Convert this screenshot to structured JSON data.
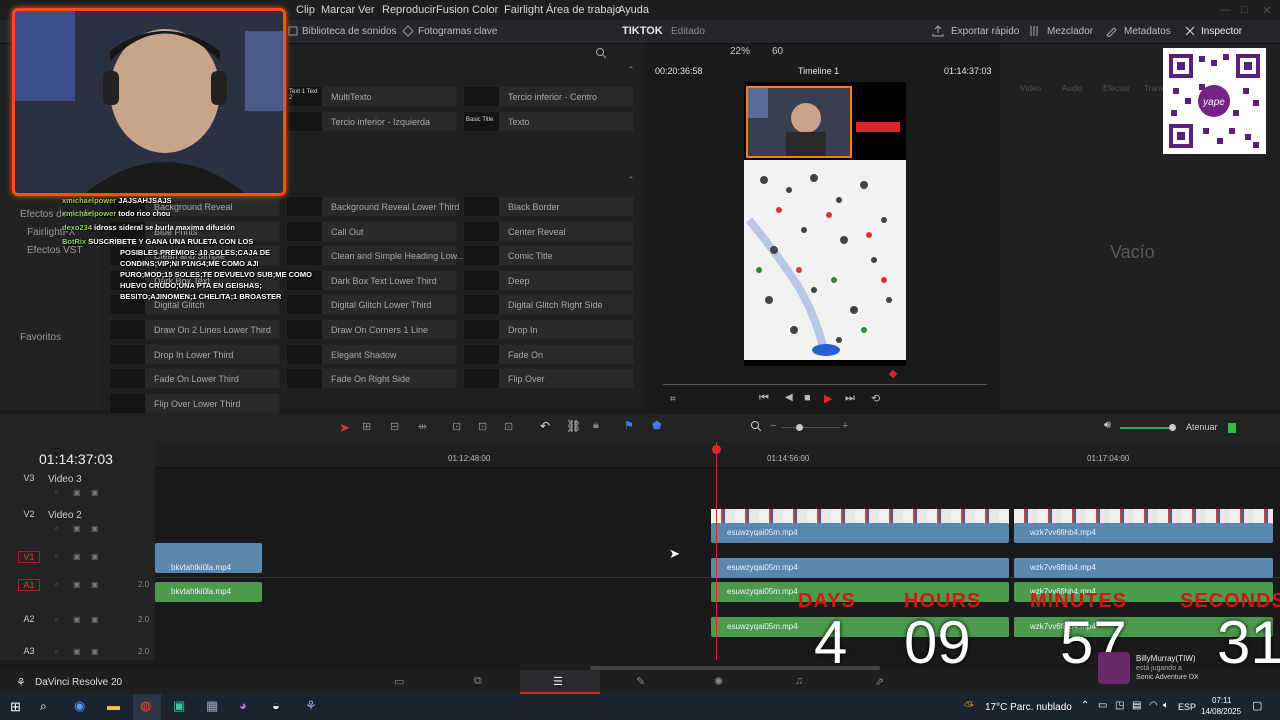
{
  "menu": {
    "items": [
      "Clip",
      "Marcar",
      "Ver",
      "Reproducir",
      "Fusion",
      "Color",
      "Fairlight",
      "Área de trabajo",
      "Ayuda"
    ]
  },
  "toolbar": {
    "sound_library": "Biblioteca de sonidos",
    "keyframes": "Fotogramas clave",
    "project_name": "TIKTOK",
    "project_status": "Editado",
    "zoom": "22%",
    "fps": "60",
    "quick_export": "Exportar rápido",
    "mixer": "Mezclador",
    "metadata": "Metadatos",
    "inspector": "Inspector"
  },
  "left_panel": {
    "items": [
      "Efectos de audio",
      "FairlightFX",
      "Efectos VST",
      "Favoritos"
    ]
  },
  "effects": {
    "top_tiles": [
      {
        "thumb": "Text 1 Text 2",
        "label": "MultiTexto"
      },
      {
        "thumb": "",
        "label": "Tercio inferior - Centro"
      },
      {
        "thumb": "",
        "label": "Tercio inferior - Izquierda"
      },
      {
        "thumb": "Basic Title",
        "label": "Texto"
      }
    ],
    "tiles": [
      {
        "label": "Background Reveal"
      },
      {
        "label": "Background Reveal Lower Third"
      },
      {
        "label": "Black Border"
      },
      {
        "label": "Blue Prints"
      },
      {
        "label": "Call Out"
      },
      {
        "label": "Center Reveal"
      },
      {
        "label": "Clean and Simple"
      },
      {
        "label": "Clean and Simple Heading Low..."
      },
      {
        "label": "Comic Title"
      },
      {
        "label": "Dark Box Text"
      },
      {
        "label": "Dark Box Text Lower Third"
      },
      {
        "label": "Deep"
      },
      {
        "label": "Digital Glitch"
      },
      {
        "label": "Digital Glitch Lower Third"
      },
      {
        "label": "Digital Glitch Right Side"
      },
      {
        "label": "Draw On 2 Lines Lower Third"
      },
      {
        "label": "Draw On Corners 1 Line"
      },
      {
        "label": "Drop In"
      },
      {
        "label": "Drop In Lower Third"
      },
      {
        "label": "Elegant Shadow"
      },
      {
        "label": "Fade On"
      },
      {
        "label": "Fade On Lower Third"
      },
      {
        "label": "Fade On Right Side"
      },
      {
        "label": "Flip Over"
      },
      {
        "label": "Flip Over Lower Third"
      }
    ]
  },
  "viewer": {
    "source_tc": "00:20:36:58",
    "timeline_name": "Timeline 1",
    "record_tc": "01:14:37:03"
  },
  "inspector": {
    "tabs": [
      "Vídeo",
      "Audio",
      "Efectos",
      "Transición"
    ],
    "empty_text": "Vacío"
  },
  "timeline_toolbar": {
    "attenuate": "Atenuar"
  },
  "timeline": {
    "timecode": "01:14:37:03",
    "ruler": [
      "01:12:48:00",
      "01:14:56:00",
      "01:17:04:00"
    ],
    "tracks": [
      {
        "id": "V3",
        "name": "Video 3"
      },
      {
        "id": "V2",
        "name": "Video 2"
      },
      {
        "id": "V1",
        "name": ""
      },
      {
        "id": "A1",
        "name": "",
        "level": "2.0"
      },
      {
        "id": "A2",
        "name": "",
        "level": "2.0"
      },
      {
        "id": "A3",
        "name": "",
        "level": "2.0"
      }
    ],
    "clips": {
      "c1": "bkvtahtki0la.mp4",
      "c2": "bkvtahtki0la.mp4",
      "c3": "esuwzyqai05m.mp4",
      "c4": "wzk7vv6fihb4.mp4",
      "c5": "esuwzyqai05m.mp4",
      "c6": "wzk7vv6fihb4.mp4",
      "c7": "esuwzyqai05m.mp4",
      "c8": "wzk7vv6fihb4.mp4",
      "c9": "esuwzyqai05m.mp4",
      "c10": "wzk7vv6fihb4.mp4"
    }
  },
  "app": {
    "name": "DaVinci Resolve 20"
  },
  "taskbar": {
    "weather": "17°C  Parc. nublado",
    "lang": "ESP",
    "time": "07:11",
    "date": "14/08/2025"
  },
  "overlay": {
    "chat": [
      {
        "user": "xmichaelpower",
        "text": "JAJSAHJSAJS"
      },
      {
        "user": "xmichaelpower",
        "text": "todo rico chou"
      },
      {
        "user": "dexo234",
        "text": "idross sideral se burla maxima difusión"
      },
      {
        "user": "BotRix",
        "text": "SUSCRIBETE Y GANA UNA RULETA CON LOS"
      },
      {
        "user": "",
        "text": "POSIBLES PREMIOS: 10 SOLES;CAJA DE"
      },
      {
        "user": "",
        "text": "CONDINS;VIP;NI P1NG4;ME COMO AJI"
      },
      {
        "user": "",
        "text": "PURO;MOD;15 SOLES;TE DEVUELVO SUB;ME COMO"
      },
      {
        "user": "",
        "text": "HUEVO CRUDO;UNA PTA EN GEISHAS;"
      },
      {
        "user": "",
        "text": "BESITO;AJINOMEN;1 CHELITA;1 BROASTER"
      }
    ],
    "countdown": {
      "labels": [
        "DAYS",
        "HOURS",
        "MINUTES",
        "SECONDS"
      ],
      "values": [
        "4",
        "09",
        "57",
        "31"
      ]
    },
    "now_playing_user": "BillyMurray(TIW)",
    "now_playing_status": "está jugando a",
    "now_playing_game": "Sonic Adventure DX"
  },
  "colors": {
    "accent_red": "#d21515",
    "clip_blue": "#5b86ad",
    "clip_green": "#4c9a4e",
    "playhead": "#e0252a"
  }
}
